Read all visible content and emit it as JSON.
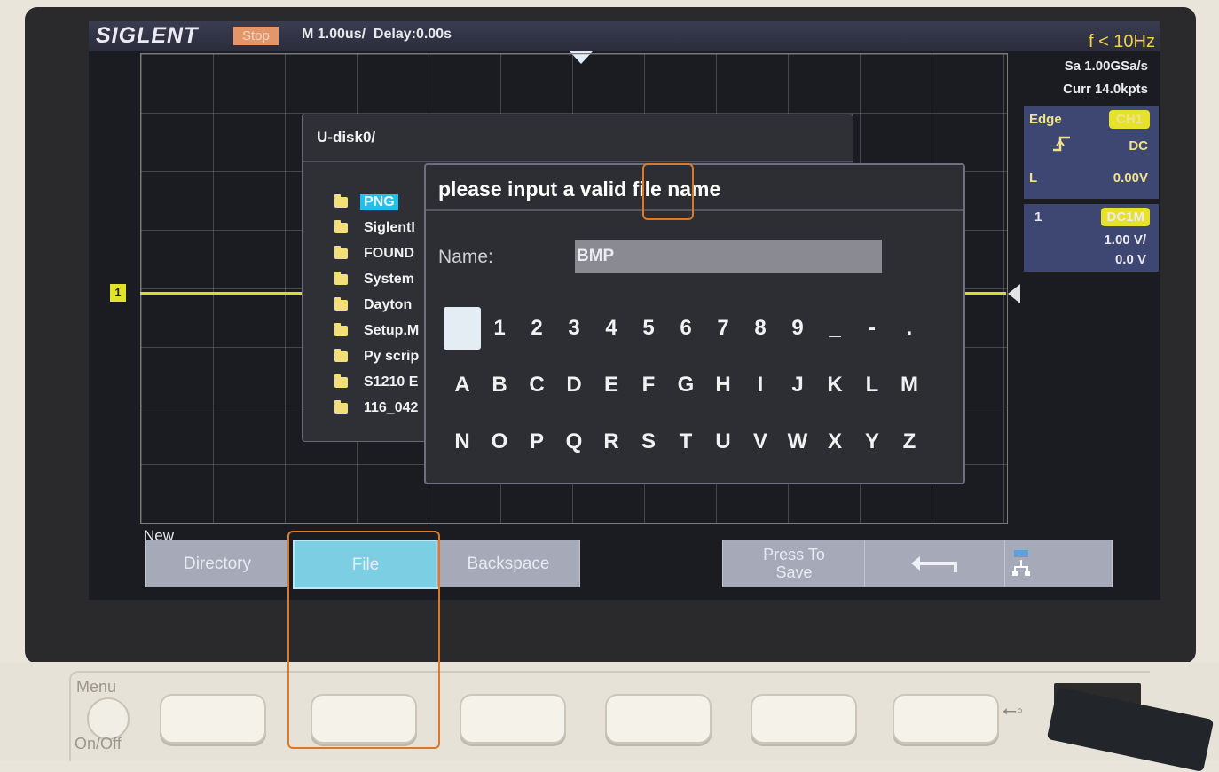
{
  "top_bar": {
    "brand": "SIGLENT",
    "run_state": "Stop",
    "timebase": "M 1.00us/",
    "delay": "Delay:0.00s",
    "frequency": "f < 10Hz"
  },
  "acquisition": {
    "sample_rate": "Sa 1.00GSa/s",
    "memory": "Curr 14.0kpts"
  },
  "trigger": {
    "type": "Edge",
    "source": "CH1",
    "slope_icon": "rising-edge-icon",
    "coupling": "DC",
    "level_label": "L",
    "level_value": "0.00V"
  },
  "channel1": {
    "number": "1",
    "coupling": "DC1M",
    "scale": "1.00 V/",
    "offset": "0.0 V",
    "color": "#d8dd25",
    "marker": "1"
  },
  "file_browser": {
    "path": "U-disk0/",
    "items": [
      {
        "name": "PNG",
        "selected": true
      },
      {
        "name": "SiglentI",
        "selected": false
      },
      {
        "name": "FOUND",
        "selected": false
      },
      {
        "name": "System",
        "selected": false
      },
      {
        "name": "Dayton",
        "selected": false
      },
      {
        "name": "Setup.M",
        "selected": false
      },
      {
        "name": "Py scrip",
        "selected": false
      },
      {
        "name": "S1210 E",
        "selected": false
      },
      {
        "name": "116_042",
        "selected": false
      }
    ]
  },
  "dialog": {
    "title": "please input a valid file name",
    "name_label": "Name:",
    "name_value": "BMP",
    "keyboard_rows": [
      [
        "",
        "1",
        "2",
        "3",
        "4",
        "5",
        "6",
        "7",
        "8",
        "9",
        "_",
        "-",
        "."
      ],
      [
        "A",
        "B",
        "C",
        "D",
        "E",
        "F",
        "G",
        "H",
        "I",
        "J",
        "K",
        "L",
        "M"
      ],
      [
        "N",
        "O",
        "P",
        "Q",
        "R",
        "S",
        "T",
        "U",
        "V",
        "W",
        "X",
        "Y",
        "Z"
      ]
    ]
  },
  "softkeys": {
    "group_label": "New",
    "directory": "Directory",
    "file": "File",
    "backspace": "Backspace",
    "press_to_save_line1": "Press To",
    "press_to_save_line2": "Save",
    "back_icon": "return-arrow-icon",
    "network_icon": "network-icon"
  },
  "front_panel": {
    "menu_label": "Menu",
    "onoff_label": "On/Off",
    "usb_icon": "usb-icon"
  },
  "colors": {
    "trace": "#d8dd25",
    "accent_selected": "#22c0ec",
    "annotation": "#d87a2a"
  }
}
